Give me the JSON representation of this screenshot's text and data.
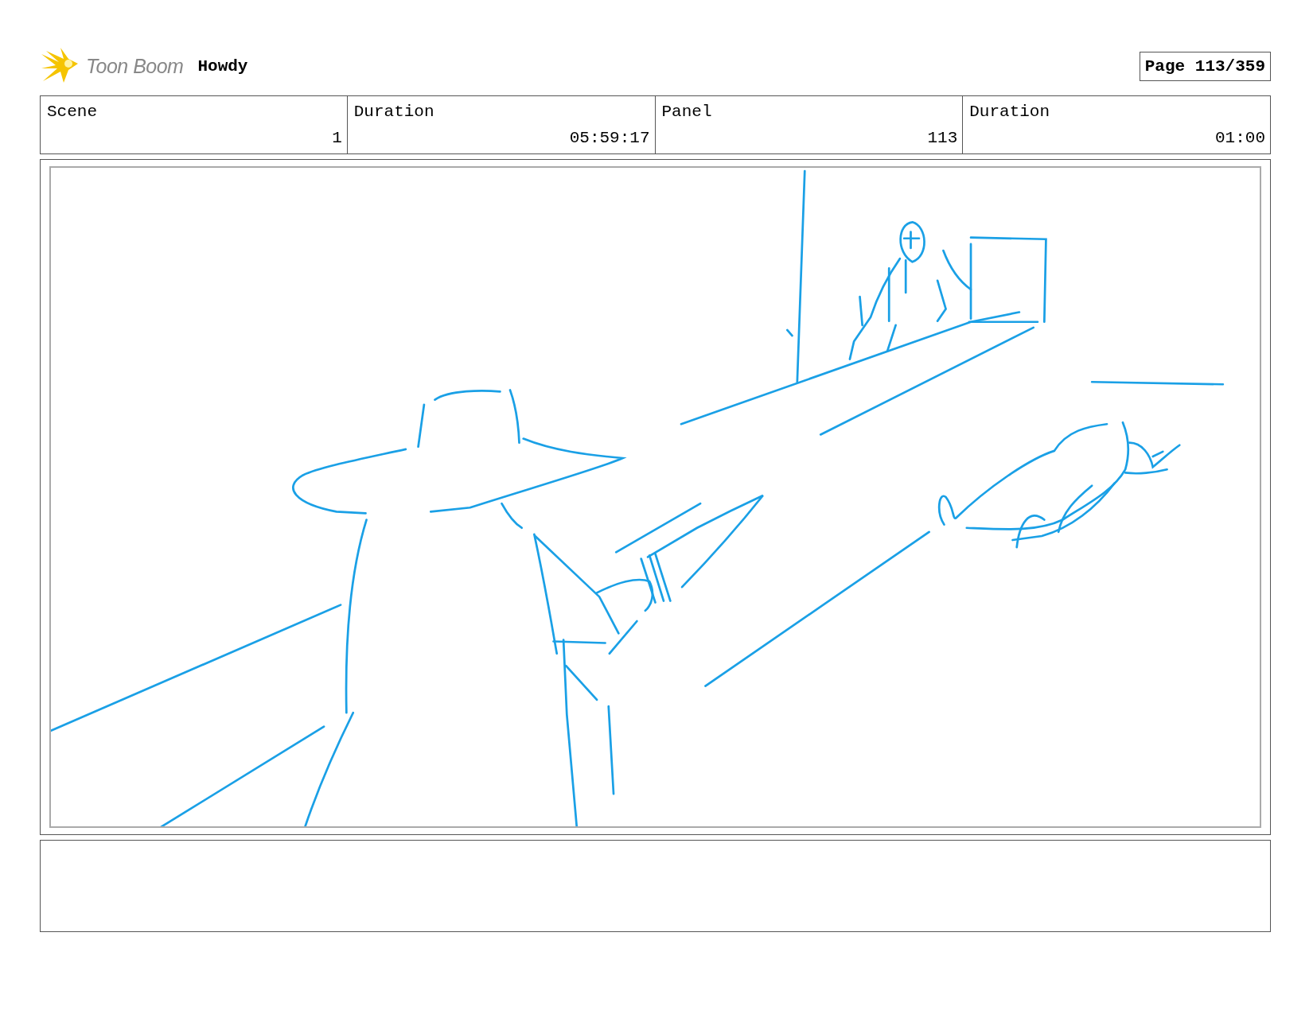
{
  "header": {
    "brand": "Toon Boom",
    "project": "Howdy",
    "page": "Page 113/359"
  },
  "fields": [
    {
      "caption": "Scene",
      "entry": "1"
    },
    {
      "caption": "Duration",
      "entry": "05:59:17"
    },
    {
      "caption": "Panel",
      "entry": "113"
    },
    {
      "caption": "Duration",
      "entry": "01:00"
    }
  ]
}
